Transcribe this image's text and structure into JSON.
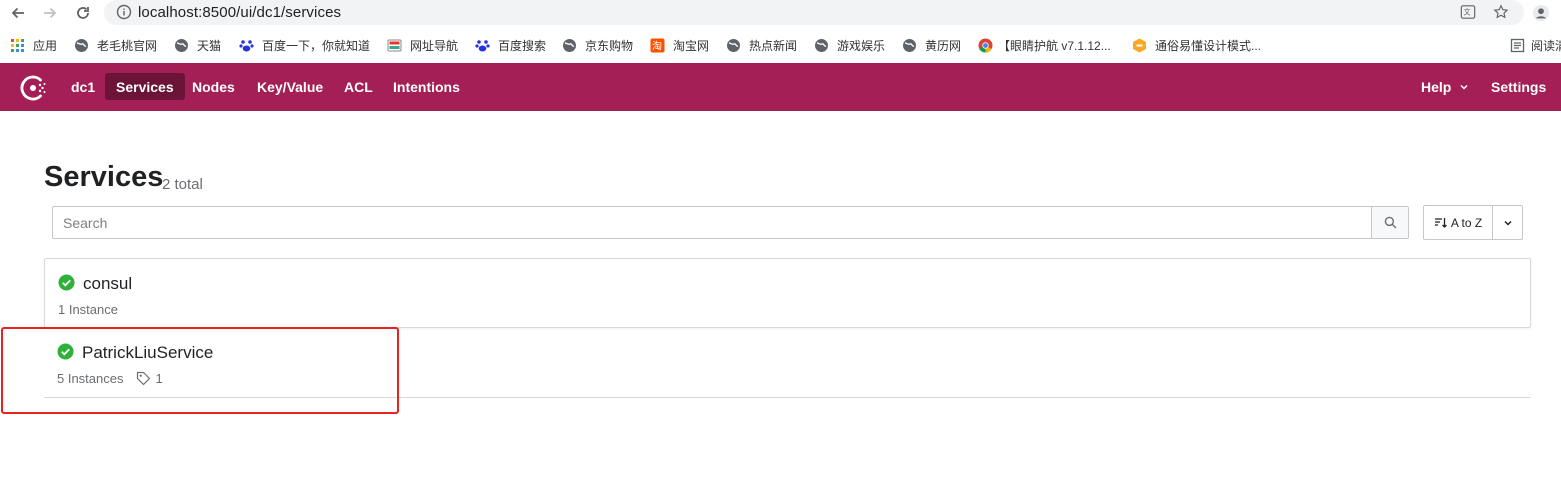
{
  "browser": {
    "url": "localhost:8500/ui/dc1/services",
    "icons": [
      "back-arrow-icon",
      "forward-arrow-icon",
      "reload-icon",
      "info-icon",
      "translate-icon",
      "star-icon",
      "account-icon"
    ],
    "bookmarks": [
      {
        "label": "应用",
        "icon": "apps-grid-icon"
      },
      {
        "label": "老毛桃官网",
        "icon": "globe-icon"
      },
      {
        "label": "天猫",
        "icon": "globe-icon"
      },
      {
        "label": "百度一下，你就知道",
        "icon": "baidu-paw-icon"
      },
      {
        "label": "网址导航",
        "icon": "nav-site-icon"
      },
      {
        "label": "百度搜索",
        "icon": "baidu-paw-icon"
      },
      {
        "label": "京东购物",
        "icon": "globe-icon"
      },
      {
        "label": "淘宝网",
        "icon": "taobao-icon"
      },
      {
        "label": "热点新闻",
        "icon": "globe-icon"
      },
      {
        "label": "游戏娱乐",
        "icon": "globe-icon"
      },
      {
        "label": "黄历网",
        "icon": "globe-icon"
      },
      {
        "label": "【眼睛护航 v7.1.12...",
        "icon": "chrome-icon"
      },
      {
        "label": "通俗易懂设计模式...",
        "icon": "hexagon-icon"
      },
      {
        "label": "阅读清",
        "icon": "reading-list-icon"
      }
    ]
  },
  "topnav": {
    "datacenter": "dc1",
    "items": [
      {
        "label": "Services",
        "active": true
      },
      {
        "label": "Nodes",
        "active": false
      },
      {
        "label": "Key/Value",
        "active": false
      },
      {
        "label": "ACL",
        "active": false
      },
      {
        "label": "Intentions",
        "active": false
      }
    ],
    "help_label": "Help",
    "settings_label": "Settings",
    "brand_color": "#a31f56",
    "active_color": "#6b1437"
  },
  "page": {
    "title": "Services",
    "total": "2 total"
  },
  "search": {
    "placeholder": "Search"
  },
  "sort": {
    "label": "A to Z"
  },
  "services": [
    {
      "name": "consul",
      "instances": "1 Instance",
      "tags": "",
      "status": "passing"
    },
    {
      "name": "PatrickLiuService",
      "instances": "5 Instances",
      "tags": "1",
      "status": "passing"
    }
  ],
  "colors": {
    "passing": "#2eb039",
    "annotation_box": "#e8221e"
  }
}
